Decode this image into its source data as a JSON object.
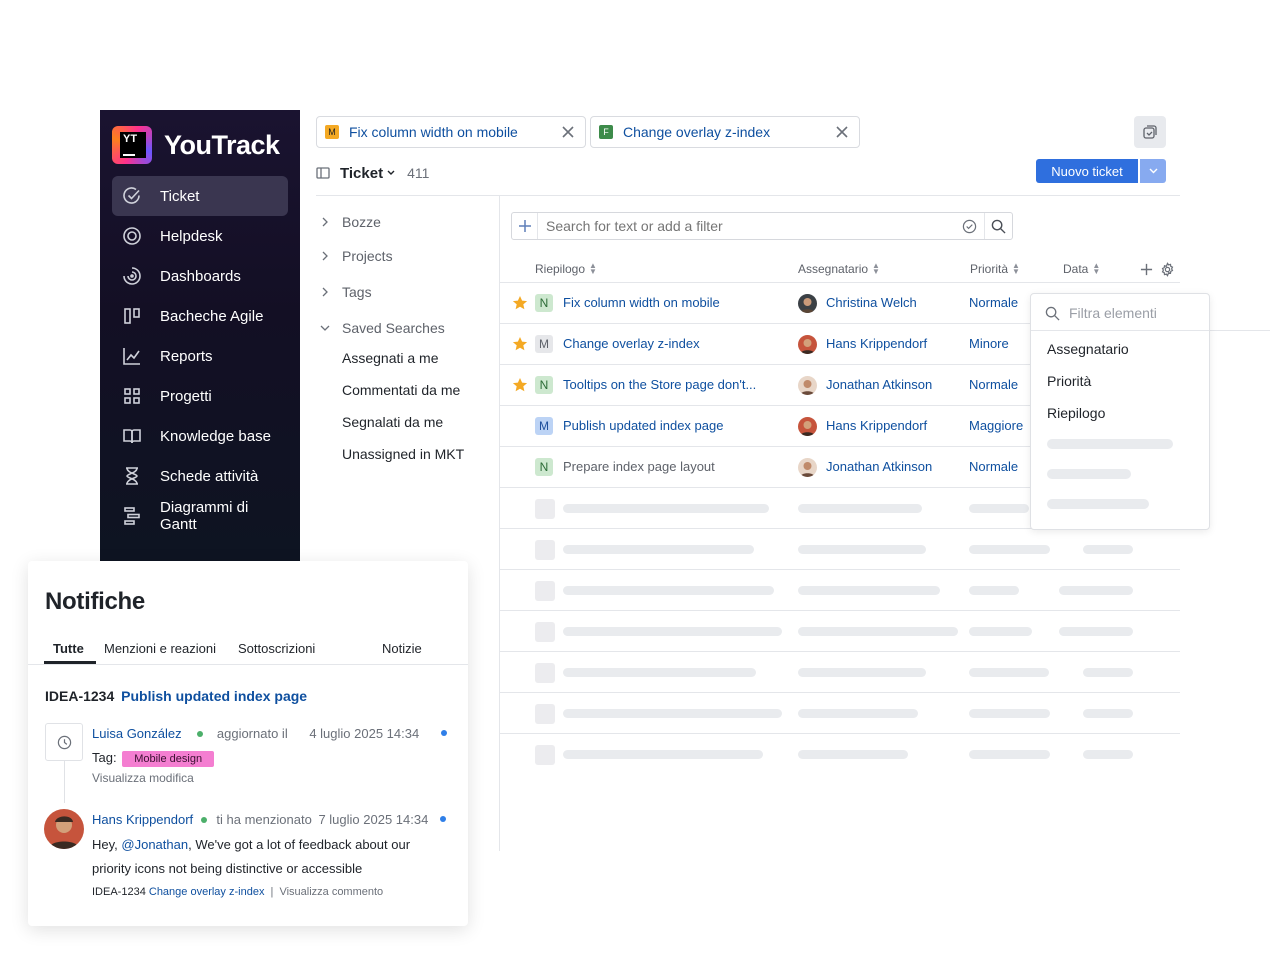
{
  "app": {
    "name": "YouTrack"
  },
  "sidebar": {
    "items": [
      {
        "label": "Ticket",
        "icon": "check-circle-icon",
        "active": true
      },
      {
        "label": "Helpdesk",
        "icon": "lifebuoy-icon"
      },
      {
        "label": "Dashboards",
        "icon": "dashboard-icon"
      },
      {
        "label": "Bacheche Agile",
        "icon": "board-icon"
      },
      {
        "label": "Reports",
        "icon": "chart-icon"
      },
      {
        "label": "Progetti",
        "icon": "grid-icon"
      },
      {
        "label": "Knowledge base",
        "icon": "book-icon"
      },
      {
        "label": "Schede attività",
        "icon": "hourglass-icon"
      },
      {
        "label": "Diagrammi di Gantt",
        "icon": "gantt-icon"
      }
    ]
  },
  "tabs": [
    {
      "badge": "M",
      "label": "Fix column width on mobile",
      "badge_color": "#f4a924"
    },
    {
      "badge": "F",
      "label": "Change overlay z-index",
      "badge_color": "#3d8b4a"
    }
  ],
  "header": {
    "title": "Ticket",
    "count": "411",
    "new_button": "Nuovo ticket"
  },
  "filters": {
    "groups": [
      "Bozze",
      "Projects",
      "Tags",
      "Saved Searches"
    ],
    "saved": [
      "Assegnati a me",
      "Commentati da me",
      "Segnalati da me",
      "Unassigned in MKT"
    ]
  },
  "search": {
    "placeholder": "Search for text or add a filter"
  },
  "columns": [
    "Riepilogo",
    "Assegnatario",
    "Priorità",
    "Data"
  ],
  "rows": [
    {
      "star": true,
      "type": "N",
      "summary": "Fix column width on mobile",
      "assignee": "Christina Welch",
      "priority": "Normale"
    },
    {
      "star": true,
      "type": "M",
      "summary": "Change overlay z-index",
      "assignee": "Hans Krippendorf",
      "priority": "Minore"
    },
    {
      "star": true,
      "type": "N",
      "summary": "Tooltips on the Store page don't...",
      "assignee": "Jonathan Atkinson",
      "priority": "Normale"
    },
    {
      "star": false,
      "type": "M",
      "summary": "Publish updated index page",
      "assignee": "Hans Krippendorf",
      "priority": "Maggiore"
    },
    {
      "star": false,
      "type": "N",
      "summary": "Prepare index page layout",
      "assignee": "Jonathan Atkinson",
      "priority": "Normale"
    }
  ],
  "dropdown": {
    "placeholder": "Filtra elementi",
    "options": [
      "Assegnatario",
      "Priorità",
      "Riepilogo"
    ]
  },
  "notifications": {
    "title": "Notifiche",
    "tabs": [
      "Tutte",
      "Menzioni e reazioni",
      "Sottoscrizioni",
      "Notizie"
    ],
    "issue_id": "IDEA-1234",
    "issue_title": "Publish updated index page",
    "update": {
      "user": "Luisa González",
      "action": "aggiornato il",
      "time": "4 luglio 2025 14:34",
      "tag_label": "Tag:",
      "tag": "Mobile design",
      "link": "Visualizza modifica"
    },
    "mention": {
      "user": "Hans Krippendorf",
      "action": "ti ha menzionato",
      "time": "7 luglio 2025 14:34",
      "text_pre": "Hey, ",
      "mention": "@Jonathan",
      "text_post": ", We've got a lot of feedback about our",
      "text_line2": "priority icons not being distinctive or accessible",
      "ref_id": "IDEA-1234",
      "ref_title": "Change overlay z-index",
      "ref_sep": "|",
      "ref_link": "Visualizza commento"
    }
  }
}
